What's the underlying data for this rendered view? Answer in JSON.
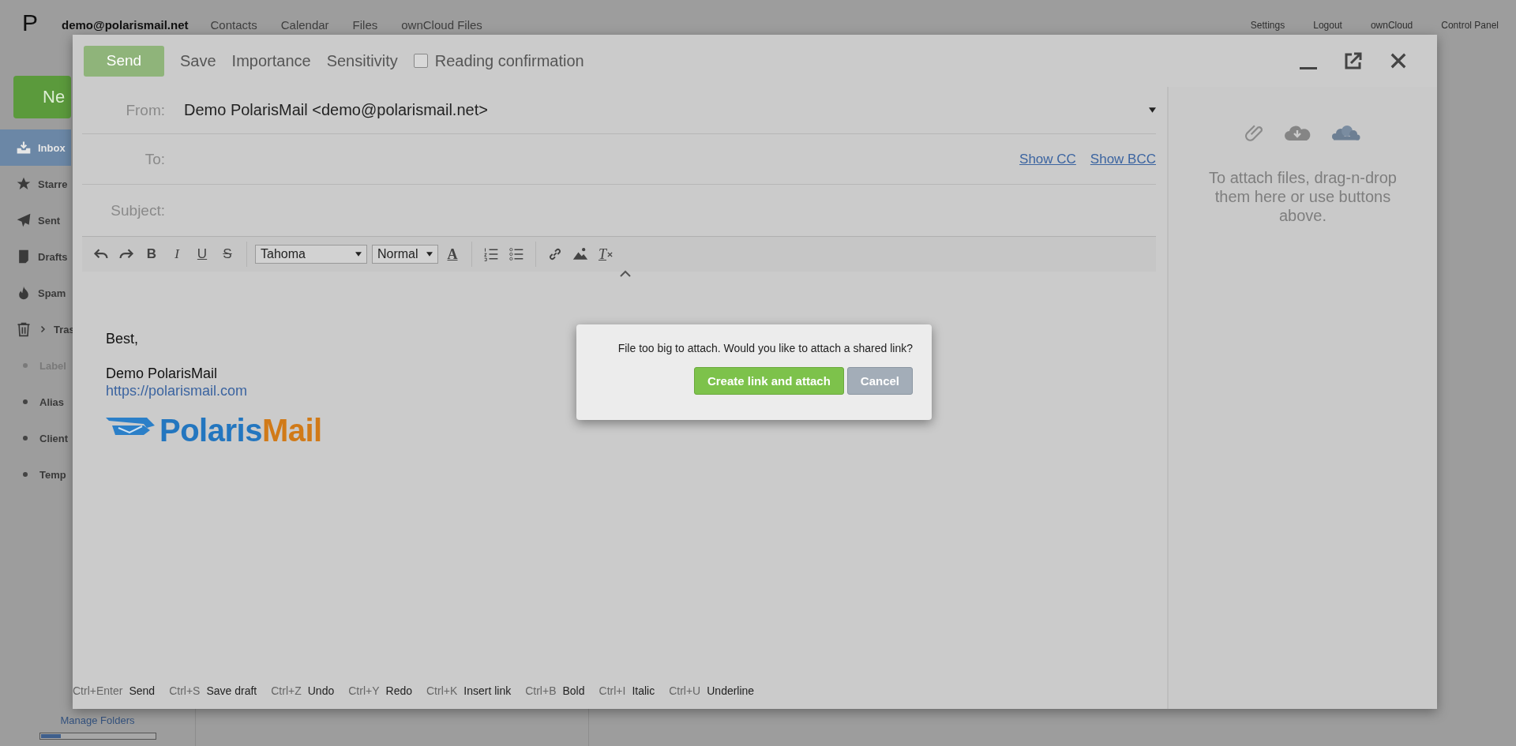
{
  "header": {
    "logo": "P",
    "account": "demo@polarismail.net",
    "nav": [
      "Contacts",
      "Calendar",
      "Files",
      "ownCloud Files"
    ],
    "links": [
      "Settings",
      "Logout",
      "ownCloud",
      "Control Panel"
    ]
  },
  "sidebar": {
    "new_button": "Ne",
    "items": [
      {
        "kind": "folder",
        "label": "Inbox",
        "selected": true
      },
      {
        "kind": "folder",
        "label": "Starre",
        "selected": false
      },
      {
        "kind": "folder",
        "label": "Sent",
        "selected": false
      },
      {
        "kind": "folder",
        "label": "Drafts",
        "selected": false
      },
      {
        "kind": "folder",
        "label": "Spam",
        "selected": false
      },
      {
        "kind": "folder",
        "label": "Tras",
        "selected": false,
        "expanded": false
      },
      {
        "kind": "group",
        "label": "Label",
        "selected": false
      },
      {
        "kind": "label",
        "label": "Alias",
        "selected": false
      },
      {
        "kind": "label",
        "label": "Client",
        "selected": false
      },
      {
        "kind": "label",
        "label": "Temp",
        "selected": false
      }
    ],
    "manage_link": "Manage Folders",
    "quota": {
      "level": 0.18
    }
  },
  "compose": {
    "send": {
      "label": "Send",
      "disabled": true
    },
    "actions": [
      "Save",
      "Importance",
      "Sensitivity"
    ],
    "reading_confirmation": {
      "label": "Reading confirmation",
      "checked": false
    },
    "from": {
      "label": "From:",
      "value": "Demo PolarisMail <demo@polarismail.net>"
    },
    "to": {
      "label": "To:",
      "links": [
        "Show CC",
        "Show BCC"
      ]
    },
    "subject": {
      "label": "Subject:"
    },
    "editor": {
      "style_buttons": [
        "B",
        "I",
        "U",
        "S"
      ],
      "font": "Tahoma",
      "size": "Normal",
      "color_button": "A",
      "clear_button": "T"
    },
    "body": {
      "paragraphs": [
        {
          "lines": [
            {
              "kind": "text",
              "text": "Best,"
            }
          ]
        },
        {
          "lines": [
            {
              "kind": "text",
              "text": "Demo PolarisMail"
            },
            {
              "kind": "link",
              "text": "https://polarismail.com"
            }
          ]
        }
      ],
      "logo": [
        "Polaris",
        "Mail"
      ]
    },
    "shortcuts": [
      {
        "keys": "Ctrl+Enter",
        "action": "Send"
      },
      {
        "keys": "Ctrl+S",
        "action": "Save draft"
      },
      {
        "keys": "Ctrl+Z",
        "action": "Undo"
      },
      {
        "keys": "Ctrl+Y",
        "action": "Redo"
      },
      {
        "keys": "Ctrl+K",
        "action": "Insert link"
      },
      {
        "keys": "Ctrl+B",
        "action": "Bold"
      },
      {
        "keys": "Ctrl+I",
        "action": "Italic"
      },
      {
        "keys": "Ctrl+U",
        "action": "Underline"
      }
    ],
    "attach_hint": "To attach files, drag-n-drop them here or use buttons above."
  },
  "dialog": {
    "message": "File too big to attach. Would you like to attach a shared link?",
    "buttons": [
      {
        "kind": "primary",
        "label": "Create link and attach"
      },
      {
        "kind": "secondary",
        "label": "Cancel"
      }
    ]
  }
}
